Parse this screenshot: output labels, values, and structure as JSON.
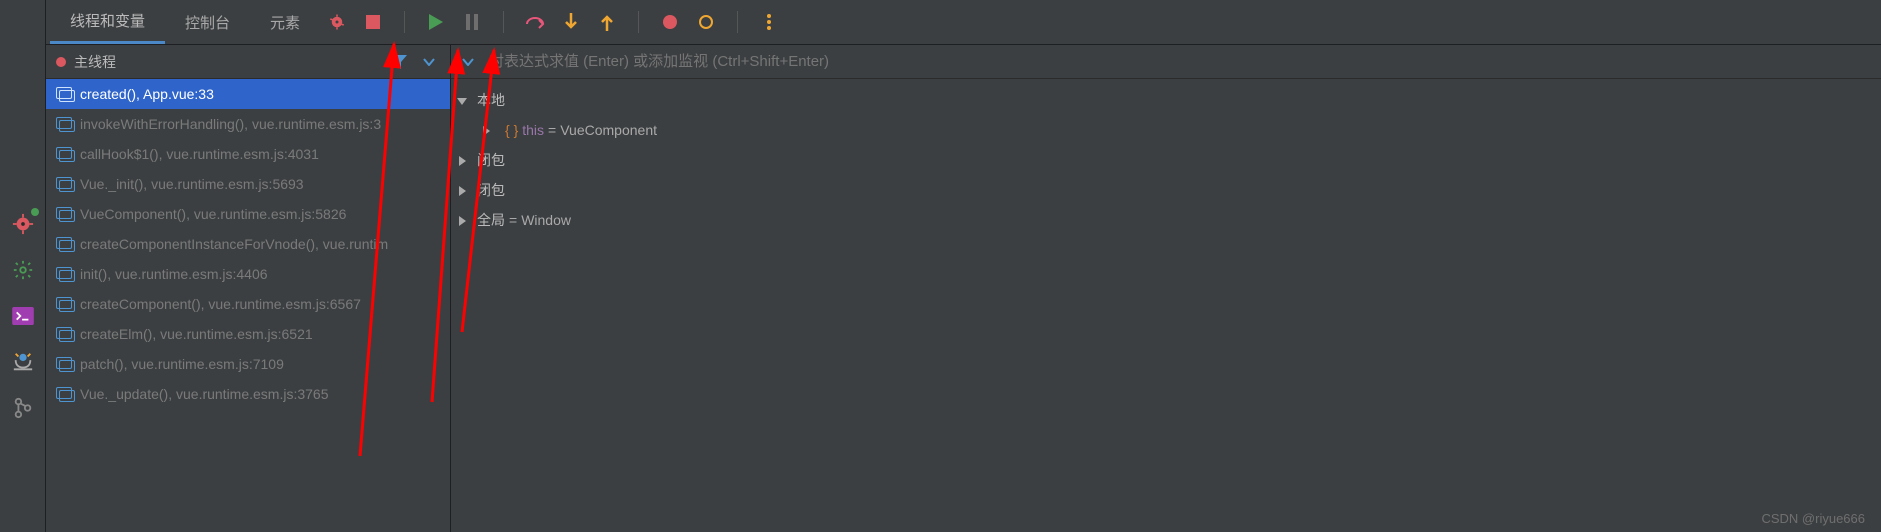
{
  "tabs": {
    "threads": "线程和变量",
    "console": "控制台",
    "elements": "元素"
  },
  "thread": "主线程",
  "expr_placeholder": "对表达式求值 (Enter) 或添加监视 (Ctrl+Shift+Enter)",
  "frames": [
    {
      "label": "created(), App.vue:33",
      "selected": true
    },
    {
      "label": "invokeWithErrorHandling(), vue.runtime.esm.js:3",
      "selected": false
    },
    {
      "label": "callHook$1(), vue.runtime.esm.js:4031",
      "selected": false
    },
    {
      "label": "Vue._init(), vue.runtime.esm.js:5693",
      "selected": false
    },
    {
      "label": "VueComponent(), vue.runtime.esm.js:5826",
      "selected": false
    },
    {
      "label": "createComponentInstanceForVnode(), vue.runtim",
      "selected": false
    },
    {
      "label": "init(), vue.runtime.esm.js:4406",
      "selected": false
    },
    {
      "label": "createComponent(), vue.runtime.esm.js:6567",
      "selected": false
    },
    {
      "label": "createElm(), vue.runtime.esm.js:6521",
      "selected": false
    },
    {
      "label": "patch(), vue.runtime.esm.js:7109",
      "selected": false
    },
    {
      "label": "Vue._update(), vue.runtime.esm.js:3765",
      "selected": false
    }
  ],
  "vars": {
    "scope_local": "本地",
    "this_label": "this",
    "this_value": "VueComponent",
    "closure1": "闭包",
    "closure2": "闭包",
    "global": "全局",
    "global_value": "Window"
  },
  "watermark": "CSDN @riyue666"
}
